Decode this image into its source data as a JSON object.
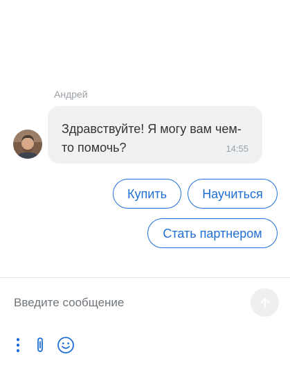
{
  "message": {
    "sender": "Андрей",
    "text": "Здравствуйте! Я могу вам чем-то помочь?",
    "time": "14:55"
  },
  "quick_replies": [
    "Купить",
    "Научиться",
    "Стать партнером"
  ],
  "composer": {
    "placeholder": "Введите сообщение",
    "send_icon": "arrow-up-icon",
    "tool_icons": [
      "more-vertical-icon",
      "paperclip-icon",
      "emoji-icon"
    ]
  },
  "colors": {
    "accent": "#1f6fd6",
    "bubble": "#f0f1f2",
    "muted_text": "#9aa0a6",
    "icon": "#1f6fd6",
    "send_bg": "#eeeff1",
    "send_arrow": "#ffffff"
  }
}
